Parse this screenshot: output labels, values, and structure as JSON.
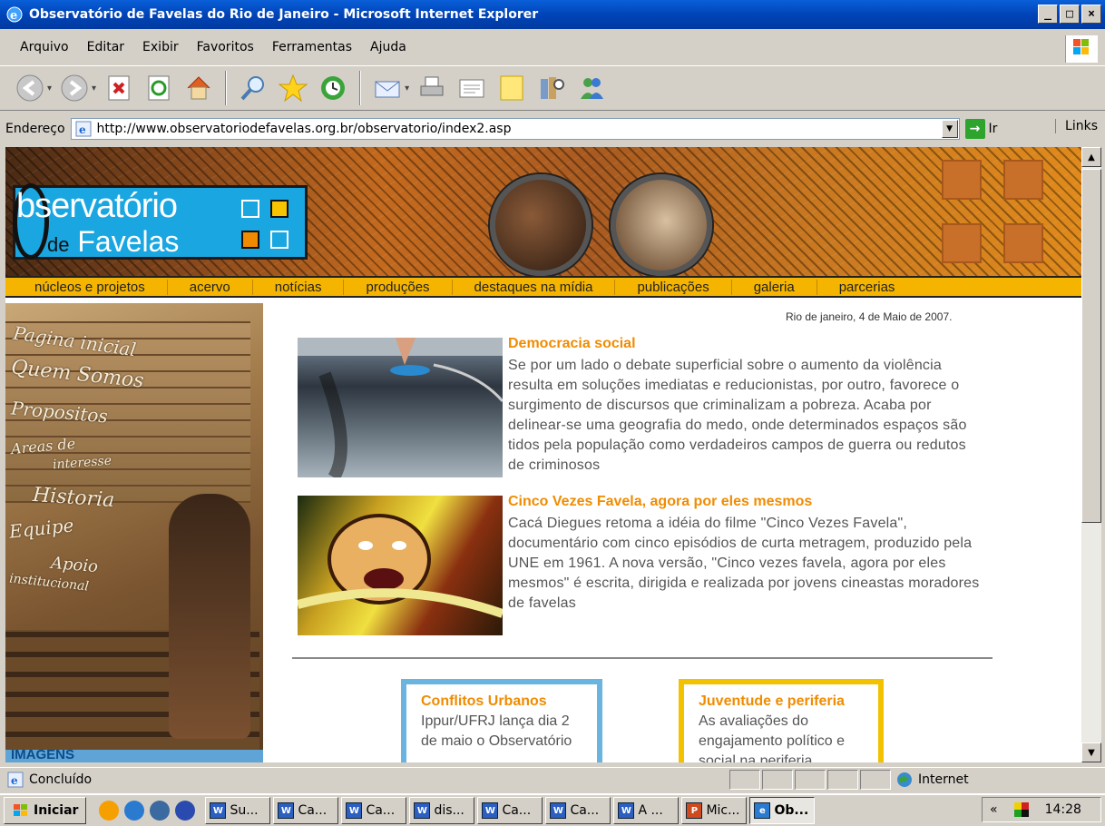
{
  "window": {
    "title": "Observatório de Favelas do Rio de Janeiro - Microsoft Internet Explorer",
    "min": "_",
    "max": "□",
    "close": "×"
  },
  "menu": [
    "Arquivo",
    "Editar",
    "Exibir",
    "Favoritos",
    "Ferramentas",
    "Ajuda"
  ],
  "toolbar": [
    "back-icon",
    "forward-icon",
    "stop-icon",
    "refresh-icon",
    "home-icon",
    "search-icon",
    "favorites-icon",
    "history-icon",
    "mail-icon",
    "print-icon",
    "edit-icon",
    "discuss-icon",
    "research-icon",
    "messenger-icon"
  ],
  "address": {
    "label": "Endereço",
    "url": "http://www.observatoriodefavelas.org.br/observatorio/index2.asp",
    "go": "Ir",
    "links": "Links"
  },
  "site": {
    "logo_line1": "bservatório",
    "logo_de": "de",
    "logo_line2": "Favelas",
    "nav": [
      "núcleos e projetos",
      "acervo",
      "notícias",
      "produções",
      "destaques na mídia",
      "publicações",
      "galeria",
      "parcerias"
    ],
    "left_menu": [
      "Pagina inicial",
      "Quem Somos",
      "Propositos",
      "Areas de",
      "interesse",
      "Historia",
      "Equipe",
      "Apoio",
      "institucional"
    ],
    "imagens_label": "IMAGENS",
    "date": "Rio de janeiro, 4 de Maio de 2007.",
    "news": [
      {
        "title": "Democracia social",
        "text": "Se por um lado o debate superficial sobre o aumento da violência resulta em soluções imediatas e reducionistas, por outro, favorece o surgimento de discursos que criminalizam a pobreza. Acaba por delinear-se uma geografia do medo, onde determinados espaços são tidos pela população como verdadeiros campos de guerra ou redutos de criminosos"
      },
      {
        "title": "Cinco Vezes Favela, agora por eles mesmos",
        "text": "Cacá Diegues retoma a idéia do filme \"Cinco Vezes Favela\", documentário com cinco episódios de curta metragem, produzido pela UNE em 1961. A nova versão, \"Cinco vezes favela, agora por eles mesmos\" é escrita, dirigida e realizada por jovens cineastas moradores de favelas"
      }
    ],
    "boxes": [
      {
        "title": "Conflitos Urbanos",
        "text": "Ippur/UFRJ lança dia 2 de maio o Observatório",
        "color": "#6ab4e0"
      },
      {
        "title": "Juventude e periferia",
        "text": "As avaliações do engajamento político e social na periferia",
        "color": "#f2c200"
      }
    ]
  },
  "status": {
    "text": "Concluído",
    "zone": "Internet"
  },
  "taskbar": {
    "start": "Iniciar",
    "tasks": [
      "Su...",
      "Ca...",
      "Ca...",
      "dis...",
      "Ca...",
      "Ca...",
      "A ...",
      "Mic...",
      "Ob..."
    ],
    "chevron": "«",
    "clock": "14:28"
  }
}
